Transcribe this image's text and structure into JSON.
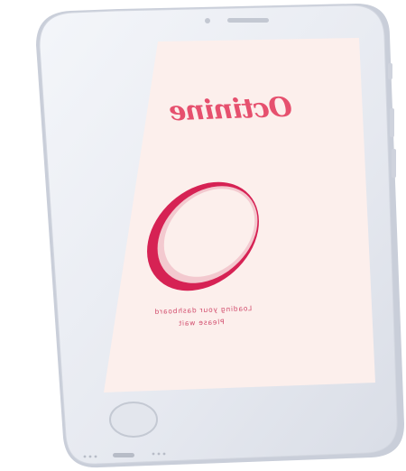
{
  "app": {
    "brand_name": "Octinine",
    "loading_line1": "Loading your dashboard",
    "loading_line2": "Please wait"
  },
  "colors": {
    "screen_background": "#fcefec",
    "accent": "#e6506e",
    "spinner_dark": "#d62254",
    "spinner_light": "#f3c9cf",
    "device_body": "#e9ecf3"
  }
}
